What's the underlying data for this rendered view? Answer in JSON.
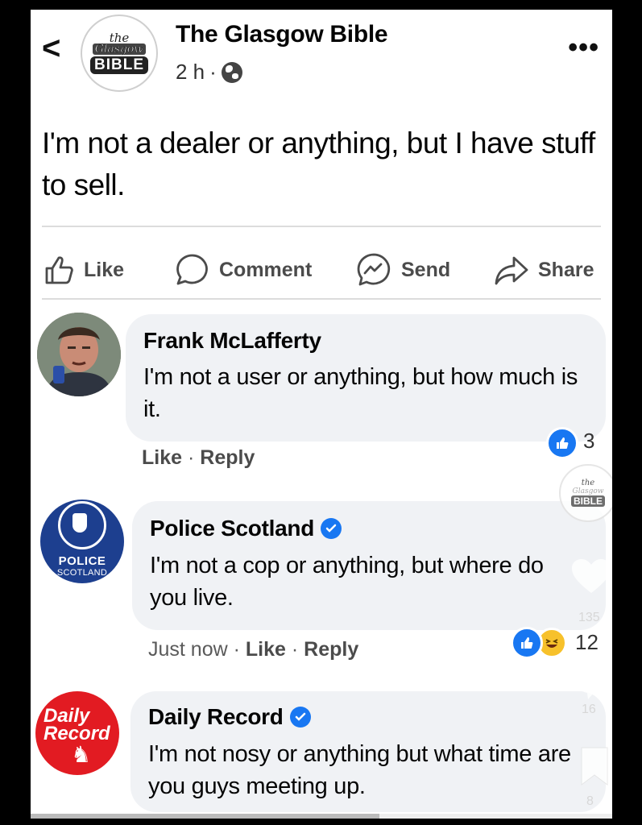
{
  "header": {
    "back_label": "<",
    "page_name": "The Glasgow Bible",
    "logo_lines": [
      "the",
      "Glasgow",
      "BIBLE"
    ],
    "time": "2 h",
    "separator": "·",
    "more_label": "•••"
  },
  "post": {
    "text": "I'm not a dealer or anything, but I have stuff to sell."
  },
  "actions": {
    "like": "Like",
    "comment": "Comment",
    "send": "Send",
    "share": "Share"
  },
  "comments": [
    {
      "author": "Frank McLafferty",
      "text": "I'm not a user or anything, but how much is it.",
      "like": "Like",
      "reply": "Reply",
      "sep": "·",
      "reactions": "3"
    },
    {
      "author": "Police Scotland",
      "verified": true,
      "avatar_lines": [
        "POLICE",
        "SCOTLAND"
      ],
      "text": "I'm not a cop or anything, but where do you live.",
      "time": "Just now",
      "like": "Like",
      "reply": "Reply",
      "sep": "·",
      "reactions": "12"
    },
    {
      "author": "Daily Record",
      "verified": true,
      "avatar_lines": [
        "Daily",
        "Record"
      ],
      "text": "I'm not nosy or anything but what time are you guys meeting up."
    }
  ],
  "overlay": {
    "logo_lines": [
      "the",
      "Glasgow",
      "BIBLE"
    ],
    "like_count": "135",
    "comment_count": "16",
    "save_count": "8"
  },
  "colors": {
    "facebook_blue": "#1877f2",
    "police_blue": "#1d3f8f",
    "daily_record_red": "#e21b22",
    "bubble_grey": "#f0f2f5"
  }
}
